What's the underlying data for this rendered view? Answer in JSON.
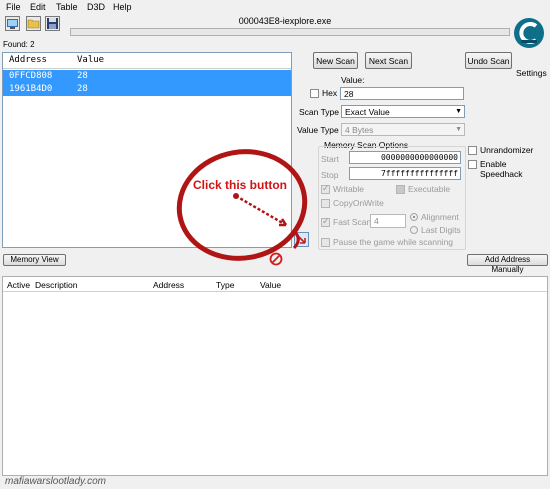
{
  "menu": {
    "items": [
      "File",
      "Edit",
      "Table",
      "D3D",
      "Help"
    ]
  },
  "toolbar": {
    "buttons": [
      {
        "name": "select-process-icon"
      },
      {
        "name": "open-folder-icon"
      },
      {
        "name": "save-disk-icon"
      }
    ]
  },
  "process_title": "000043E8-iexplore.exe",
  "found": "Found: 2",
  "results": {
    "columns": [
      "Address",
      "Value"
    ],
    "rows": [
      {
        "address": "0FFCD808",
        "value": "28"
      },
      {
        "address": "1961B4D0",
        "value": "28"
      }
    ]
  },
  "scan_buttons": {
    "new_scan": "New Scan",
    "next_scan": "Next Scan",
    "undo_scan": "Undo Scan"
  },
  "settings_label": "Settings",
  "logo_icon": "cheat-engine-logo-icon",
  "value_label": "Value:",
  "hex_label": "Hex",
  "value_input": "28",
  "scan_type": {
    "label": "Scan Type",
    "selected": "Exact Value"
  },
  "value_type": {
    "label": "Value Type",
    "selected": "4 Bytes"
  },
  "memory_options": {
    "title": "Memory Scan Options",
    "start_label": "Start",
    "start_value": "0000000000000000",
    "stop_label": "Stop",
    "stop_value": "7fffffffffffffff",
    "writable": "Writable",
    "executable": "Executable",
    "copy_on_write": "CopyOnWrite",
    "fast_scan": "Fast Scan",
    "fast_scan_value": "4",
    "alignment": "Alignment",
    "last_digits": "Last Digits",
    "pause_game": "Pause the game while scanning"
  },
  "right_options": {
    "unrandomizer": "Unrandomizer",
    "enable_speedhack": "Enable Speedhack"
  },
  "annotation": "Click this button",
  "memory_view_button": "Memory View",
  "add_address_button": "Add Address Manually",
  "address_list": {
    "columns": [
      "Active",
      "Description",
      "Address",
      "Type",
      "Value"
    ]
  },
  "watermark": "mafiawarslootlady.com",
  "colors": {
    "selection": "#3399ff",
    "annotation_red": "#d01313",
    "logo_teal": "#0e6f8a"
  }
}
